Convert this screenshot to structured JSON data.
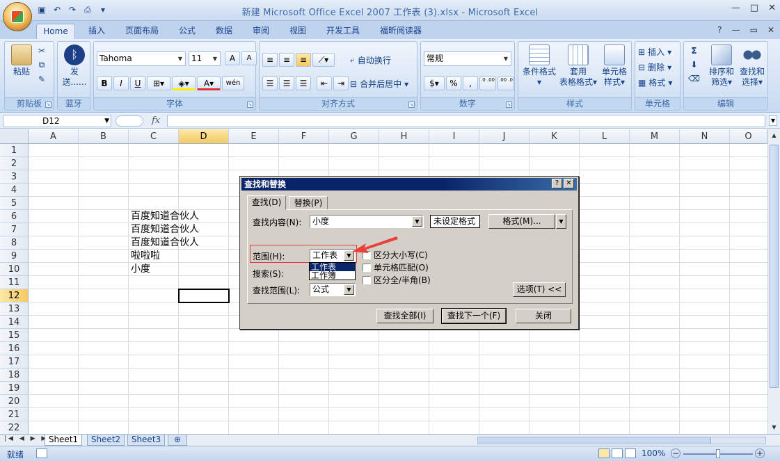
{
  "window": {
    "title": "新建 Microsoft Office Excel 2007 工作表 (3).xlsx - Microsoft Excel"
  },
  "tabs": [
    "Home",
    "插入",
    "页面布局",
    "公式",
    "数据",
    "审阅",
    "视图",
    "开发工具",
    "福昕阅读器"
  ],
  "ribbon": {
    "clipboard": {
      "paste": "粘贴",
      "label": "剪贴板"
    },
    "bluetooth": {
      "send": "发送......",
      "label": "蓝牙"
    },
    "font": {
      "name": "Tahoma",
      "size": "11",
      "label": "字体",
      "bold": "B",
      "italic": "I",
      "underline": "U",
      "grow": "A",
      "shrink": "A",
      "font_color": "A",
      "phonetic": "wén"
    },
    "alignment": {
      "wrap": "自动换行",
      "merge": "合并后居中",
      "label": "对齐方式"
    },
    "number": {
      "format": "常规",
      "percent": "%",
      "comma": ",",
      "inc_dec": ".0 .00",
      "dec_dec": ".00 .0",
      "label": "数字"
    },
    "styles": {
      "conditional": "条件格式",
      "table": "套用",
      "table2": "表格格式",
      "cell": "单元格",
      "cell2": "样式",
      "label": "样式"
    },
    "cells": {
      "insert": "插入",
      "delete": "删除",
      "format": "格式",
      "label": "单元格"
    },
    "editing": {
      "sigma": "Σ",
      "sort": "排序和",
      "sort2": "筛选",
      "find": "查找和",
      "find2": "选择",
      "label": "编辑"
    }
  },
  "formula_bar": {
    "name_box": "D12",
    "fx": "fx",
    "value": ""
  },
  "sheet": {
    "columns": [
      "A",
      "B",
      "C",
      "D",
      "E",
      "F",
      "G",
      "H",
      "I",
      "J",
      "K",
      "L",
      "M",
      "N",
      "O"
    ],
    "rows": [
      "1",
      "2",
      "3",
      "4",
      "5",
      "6",
      "7",
      "8",
      "9",
      "10",
      "11",
      "12",
      "13",
      "14",
      "15",
      "16",
      "17",
      "18",
      "19",
      "20",
      "21",
      "22"
    ],
    "cells": {
      "C6": "百度知道合伙人",
      "C7": "百度知道合伙人",
      "C8": "百度知道合伙人",
      "C9": "啦啦啦",
      "C10": "小度"
    },
    "active_cell": "D12"
  },
  "sheet_tabs": [
    "Sheet1",
    "Sheet2",
    "Sheet3"
  ],
  "status": {
    "ready": "就绪",
    "zoom": "100%"
  },
  "dialog": {
    "title": "查找和替换",
    "tab_find": "查找(D)",
    "tab_replace": "替换(P)",
    "find_what_label": "查找内容(N):",
    "find_what_value": "小度",
    "format_status": "未设定格式",
    "format_button": "格式(M)...",
    "within_label": "范围(H):",
    "within_value": "工作表",
    "within_options": [
      "工作表",
      "工作簿"
    ],
    "search_label": "搜索(S):",
    "lookin_label": "查找范围(L):",
    "lookin_value": "公式",
    "match_case": "区分大小写(C)",
    "match_entire": "单元格匹配(O)",
    "match_byte": "区分全/半角(B)",
    "options_button": "选项(T) <<",
    "find_all": "查找全部(I)",
    "find_next": "查找下一个(F)",
    "close": "关闭"
  }
}
